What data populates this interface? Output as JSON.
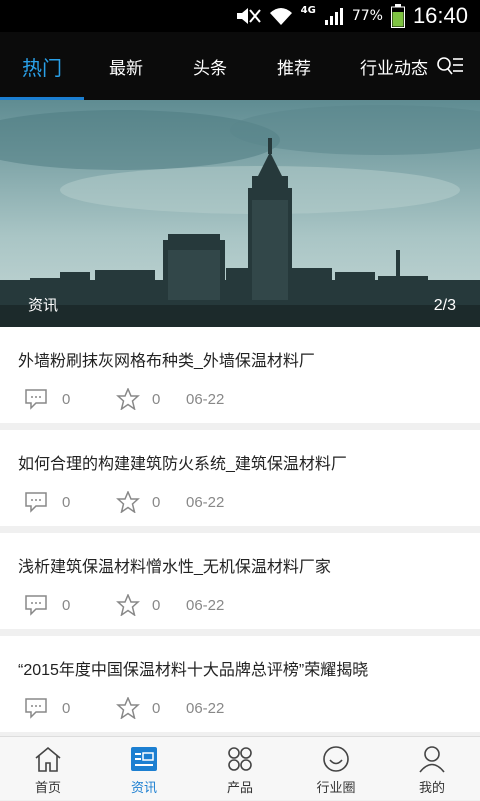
{
  "status_bar": {
    "network": "4G",
    "battery": "77%",
    "time": "16:40"
  },
  "tabs": [
    {
      "label": "热门",
      "active": true
    },
    {
      "label": "最新",
      "active": false
    },
    {
      "label": "头条",
      "active": false
    },
    {
      "label": "推荐",
      "active": false
    },
    {
      "label": "行业动态",
      "active": false
    }
  ],
  "banner": {
    "caption": "资讯",
    "counter": "2/3"
  },
  "news": [
    {
      "title": "外墙粉刷抹灰网格布种类_外墙保温材料厂",
      "comments": "0",
      "favorites": "0",
      "date": "06-22"
    },
    {
      "title": "如何合理的构建建筑防火系统_建筑保温材料厂",
      "comments": "0",
      "favorites": "0",
      "date": "06-22"
    },
    {
      "title": "浅析建筑保温材料憎水性_无机保温材料厂家",
      "comments": "0",
      "favorites": "0",
      "date": "06-22"
    },
    {
      "title": "“2015年度中国保温材料十大品牌总评榜”荣耀揭晓",
      "comments": "0",
      "favorites": "0",
      "date": "06-22"
    }
  ],
  "bottom_nav": [
    {
      "label": "首页",
      "icon": "home-icon",
      "active": false
    },
    {
      "label": "资讯",
      "icon": "news-icon",
      "active": true
    },
    {
      "label": "产品",
      "icon": "products-icon",
      "active": false
    },
    {
      "label": "行业圈",
      "icon": "community-icon",
      "active": false
    },
    {
      "label": "我的",
      "icon": "profile-icon",
      "active": false
    }
  ],
  "colors": {
    "accent": "#1c7fd1",
    "tab_bar_bg": "#0b0b0b",
    "status_bar_bg": "#000000"
  }
}
